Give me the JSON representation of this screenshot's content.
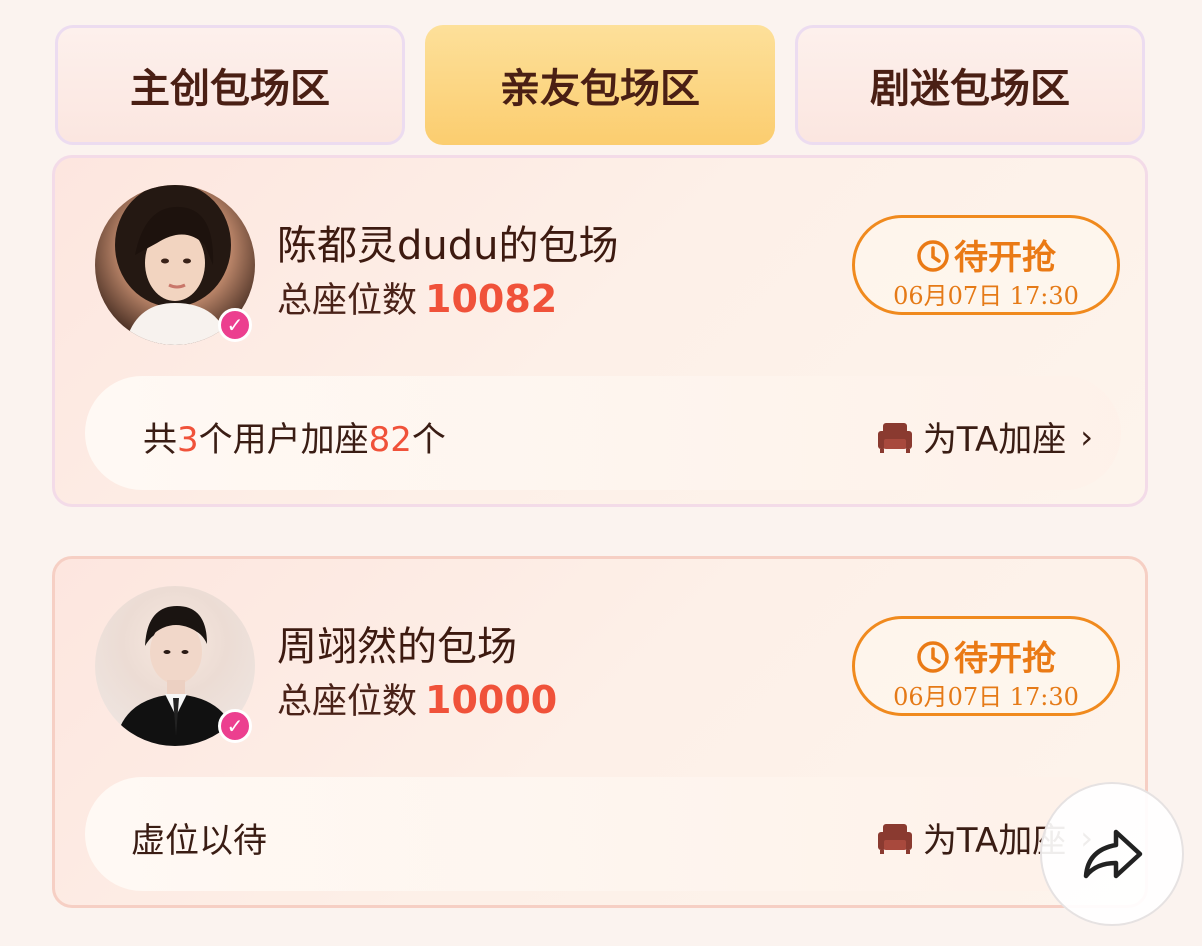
{
  "tabs": [
    {
      "label": "主创包场区",
      "active": false
    },
    {
      "label": "亲友包场区",
      "active": true
    },
    {
      "label": "剧迷包场区",
      "active": false
    }
  ],
  "cards": [
    {
      "name": "陈都灵dudu的包场",
      "seats_label": "总座位数",
      "seats_value": "10082",
      "status": "待开抢",
      "time": "06月07日 17:30",
      "bar_prefix": "共",
      "bar_users": "3",
      "bar_middle": "个用户加座",
      "bar_seats": "82",
      "bar_suffix": "个",
      "action": "为TA加座"
    },
    {
      "name": "周翊然的包场",
      "seats_label": "总座位数",
      "seats_value": "10000",
      "status": "待开抢",
      "time": "06月07日 17:30",
      "bar_text": "虚位以待",
      "action": "为TA加座"
    }
  ],
  "icons": {
    "verified": "verified-badge-icon",
    "clock": "clock-icon",
    "sofa": "sofa-icon",
    "chevron": "chevron-right-icon",
    "share": "share-icon"
  },
  "colors": {
    "accent_red": "#f0523a",
    "status_orange": "#ea7a15",
    "active_tab": "#fbcd6f",
    "verified_pink": "#ec3f8f"
  }
}
